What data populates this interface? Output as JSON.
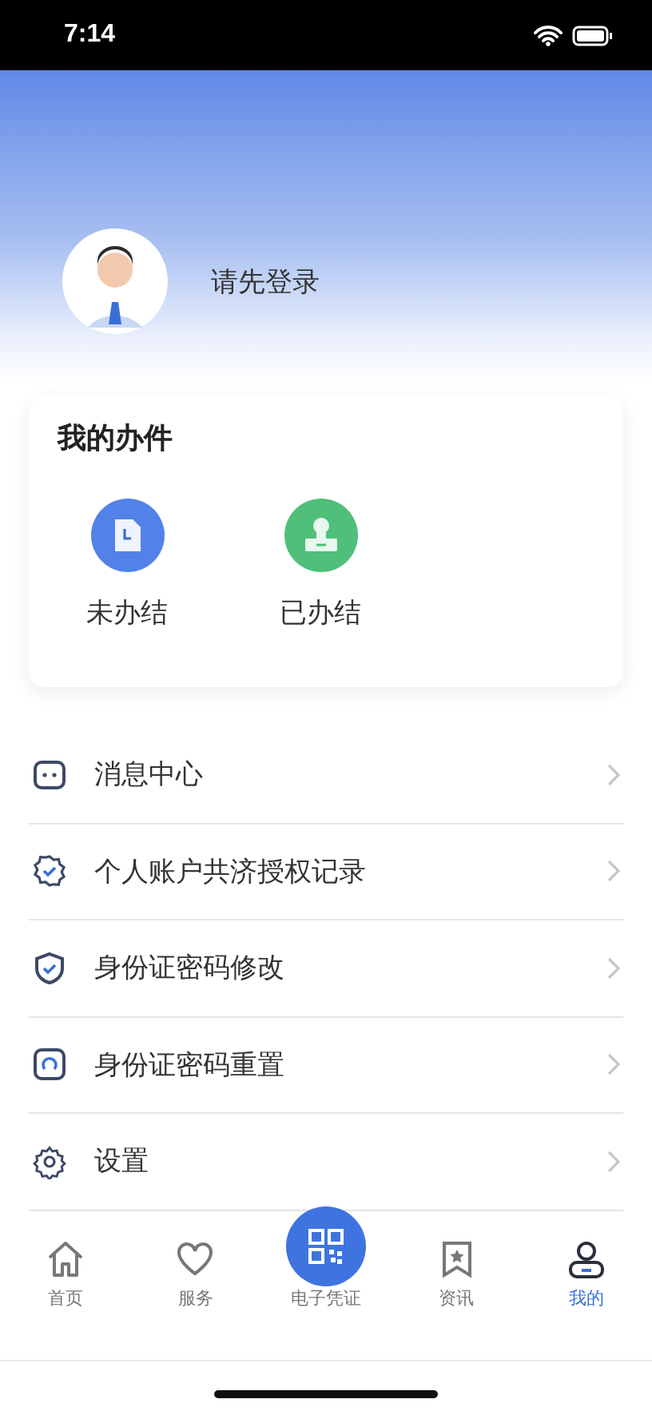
{
  "status_bar": {
    "time": "7:14"
  },
  "profile": {
    "login_prompt": "请先登录"
  },
  "my_tasks": {
    "title": "我的办件",
    "items": [
      {
        "label": "未办结",
        "kind": "pending"
      },
      {
        "label": "已办结",
        "kind": "done"
      }
    ]
  },
  "menu": [
    {
      "label": "消息中心",
      "kind": "message"
    },
    {
      "label": "个人账户共济授权记录",
      "kind": "badge"
    },
    {
      "label": "身份证密码修改",
      "kind": "shield"
    },
    {
      "label": "身份证密码重置",
      "kind": "reset"
    },
    {
      "label": "设置",
      "kind": "settings"
    }
  ],
  "tab_bar": [
    {
      "label": "首页",
      "kind": "home",
      "selected": false
    },
    {
      "label": "服务",
      "kind": "heart",
      "selected": false
    },
    {
      "label": "电子凭证",
      "kind": "qr",
      "selected": false
    },
    {
      "label": "资讯",
      "kind": "bookmark",
      "selected": false
    },
    {
      "label": "我的",
      "kind": "person",
      "selected": true
    }
  ]
}
